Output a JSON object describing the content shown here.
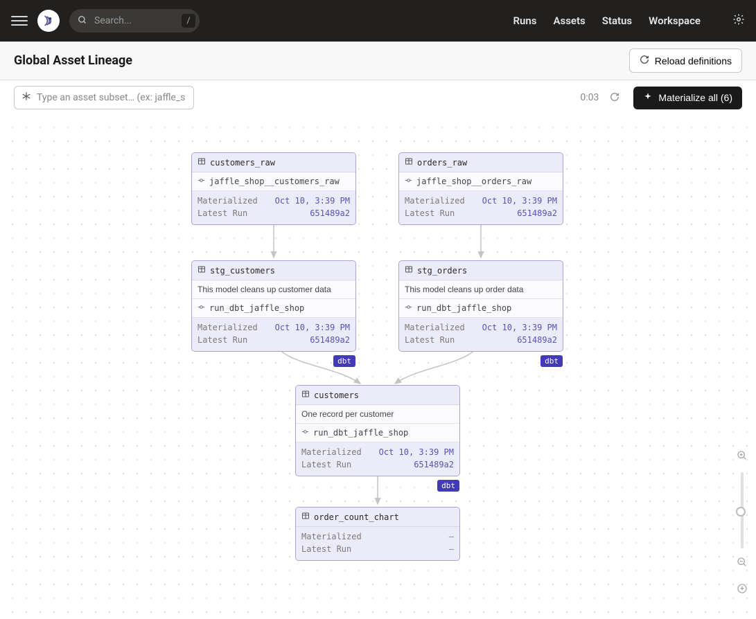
{
  "topbar": {
    "search_placeholder": "Search...",
    "search_key": "/",
    "nav": {
      "runs": "Runs",
      "assets": "Assets",
      "status": "Status",
      "workspace": "Workspace"
    }
  },
  "subbar": {
    "title": "Global Asset Lineage",
    "reload_label": "Reload definitions"
  },
  "toolbar": {
    "subset_placeholder": "Type an asset subset… (ex: jaffle_s",
    "timer": "0:03",
    "materialize_label": "Materialize all (6)"
  },
  "labels": {
    "materialized": "Materialized",
    "latest_run": "Latest Run",
    "dbt": "dbt"
  },
  "nodes": {
    "customers_raw": {
      "name": "customers_raw",
      "job": "jaffle_shop__customers_raw",
      "materialized": "Oct 10, 3:39 PM",
      "latest_run": "651489a2"
    },
    "orders_raw": {
      "name": "orders_raw",
      "job": "jaffle_shop__orders_raw",
      "materialized": "Oct 10, 3:39 PM",
      "latest_run": "651489a2"
    },
    "stg_customers": {
      "name": "stg_customers",
      "desc": "This model cleans up customer data",
      "job": "run_dbt_jaffle_shop",
      "materialized": "Oct 10, 3:39 PM",
      "latest_run": "651489a2"
    },
    "stg_orders": {
      "name": "stg_orders",
      "desc": "This model cleans up order data",
      "job": "run_dbt_jaffle_shop",
      "materialized": "Oct 10, 3:39 PM",
      "latest_run": "651489a2"
    },
    "customers": {
      "name": "customers",
      "desc": "One record per customer",
      "job": "run_dbt_jaffle_shop",
      "materialized": "Oct 10, 3:39 PM",
      "latest_run": "651489a2"
    },
    "order_count_chart": {
      "name": "order_count_chart",
      "materialized": "–",
      "latest_run": "–"
    }
  }
}
